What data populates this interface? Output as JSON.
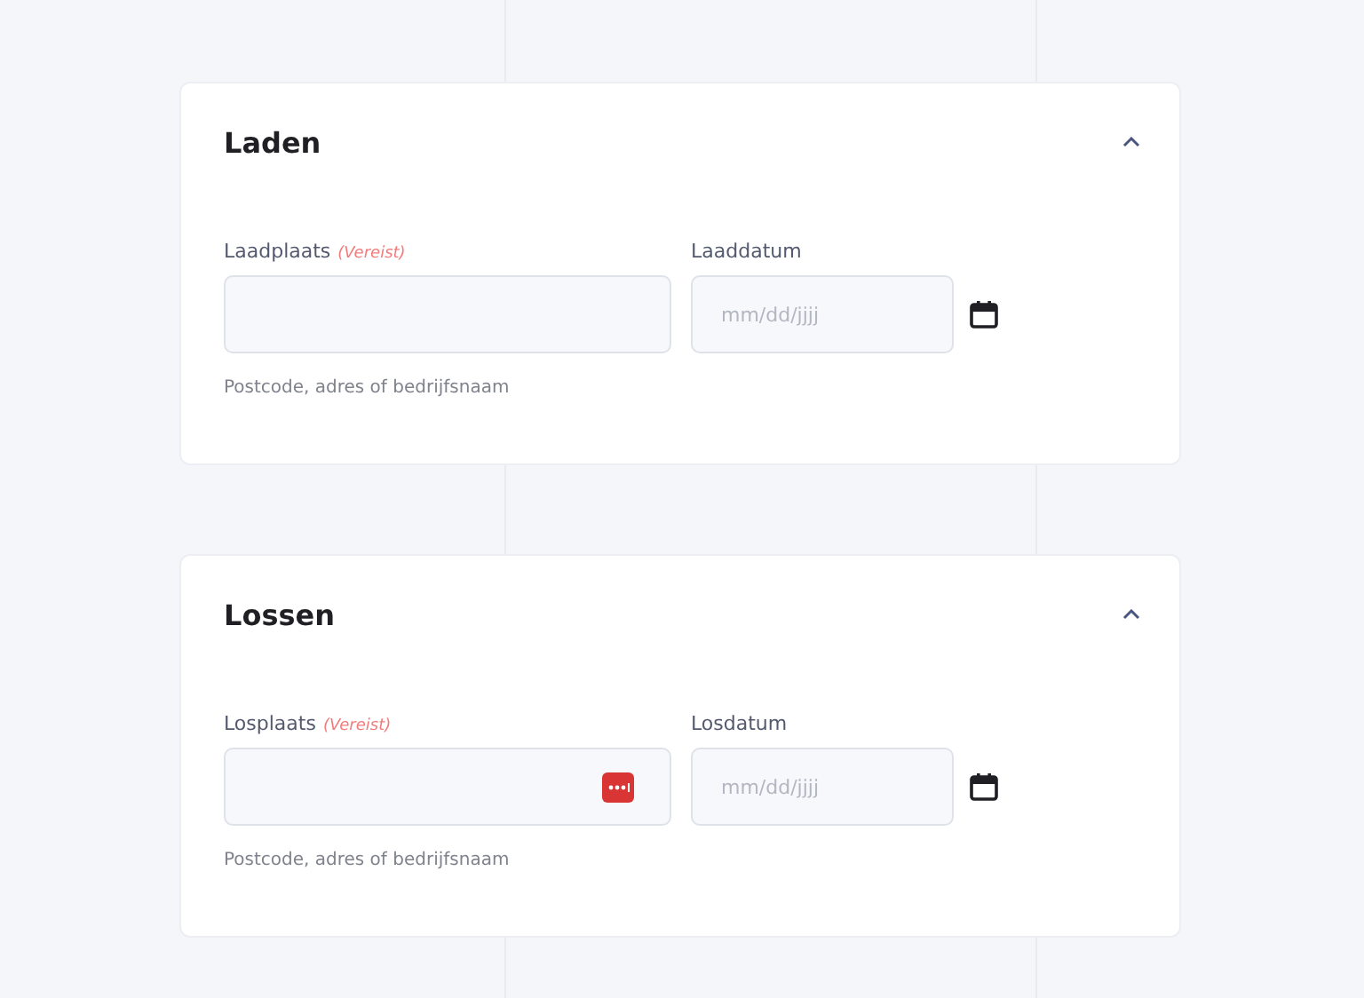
{
  "sections": [
    {
      "title": "Laden",
      "expanded": true,
      "place": {
        "label": "Laadplaats",
        "required": "(Vereist)",
        "autofill_icon": false,
        "hint": "Postcode, adres of bedrijfsnaam"
      },
      "date": {
        "label": "Laaddatum",
        "placeholder": "mm/dd/jjjj"
      }
    },
    {
      "title": "Lossen",
      "expanded": true,
      "place": {
        "label": "Losplaats",
        "required": "(Vereist)",
        "autofill_icon": true,
        "hint": "Postcode, adres of bedrijfsnaam"
      },
      "date": {
        "label": "Losdatum",
        "placeholder": "mm/dd/jjjj"
      }
    }
  ]
}
